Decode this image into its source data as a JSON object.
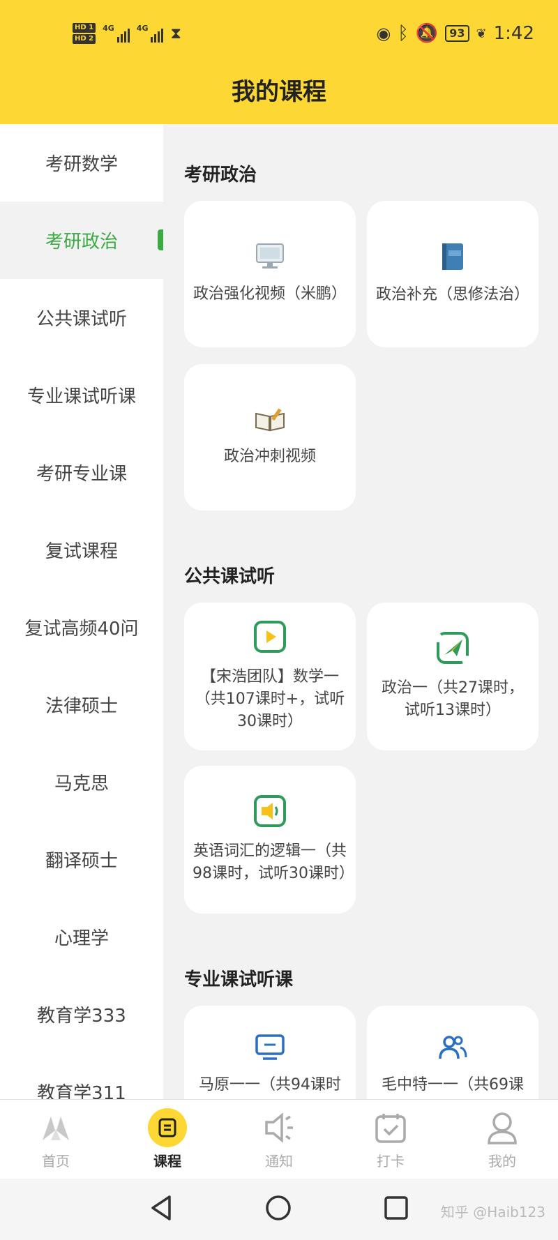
{
  "status_bar": {
    "sim1": "HD 1",
    "sim2": "HD 2",
    "net1": "4G",
    "net2": "4G",
    "battery": "93",
    "time": "1:42"
  },
  "header": {
    "title": "我的课程"
  },
  "sidebar": {
    "items": [
      {
        "label": "考研数学"
      },
      {
        "label": "考研政治"
      },
      {
        "label": "公共课试听"
      },
      {
        "label": "专业课试听课"
      },
      {
        "label": "考研专业课"
      },
      {
        "label": "复试课程"
      },
      {
        "label": "复试高频40问"
      },
      {
        "label": "法律硕士"
      },
      {
        "label": "马克思"
      },
      {
        "label": "翻译硕士"
      },
      {
        "label": "心理学"
      },
      {
        "label": "教育学333"
      },
      {
        "label": "教育学311"
      }
    ],
    "active_index": 1
  },
  "sections": [
    {
      "title": "考研政治",
      "cards": [
        {
          "label": "政治强化视频（米鹏）",
          "icon": "computer-icon"
        },
        {
          "label": "政治补充（思修法治）",
          "icon": "book-icon"
        },
        {
          "label": "政治冲刺视频",
          "icon": "open-book-pencil-icon"
        }
      ]
    },
    {
      "title": "公共课试听",
      "cards": [
        {
          "label": "【宋浩团队】数学一（共107课时+，试听30课时）",
          "icon": "play-icon"
        },
        {
          "label": "政治一（共27课时，试听13课时）",
          "icon": "paper-plane-icon"
        },
        {
          "label": "英语词汇的逻辑一（共98课时，试听30课时）",
          "icon": "speaker-icon"
        }
      ]
    },
    {
      "title": "专业课试听课",
      "cards": [
        {
          "label": "马原一一（共94课时",
          "icon": "monitor-icon"
        },
        {
          "label": "毛中特一一（共69课",
          "icon": "people-icon"
        }
      ]
    }
  ],
  "bottom_nav": {
    "items": [
      {
        "label": "首页",
        "icon": "home-logo-icon"
      },
      {
        "label": "课程",
        "icon": "course-icon"
      },
      {
        "label": "通知",
        "icon": "speaker-icon"
      },
      {
        "label": "打卡",
        "icon": "calendar-check-icon"
      },
      {
        "label": "我的",
        "icon": "user-icon"
      }
    ],
    "active_index": 1
  },
  "watermark": "知乎 @Haib123",
  "colors": {
    "header_bg": "#fdd835",
    "accent_green": "#3caa43",
    "content_bg": "#f2f2f2"
  }
}
